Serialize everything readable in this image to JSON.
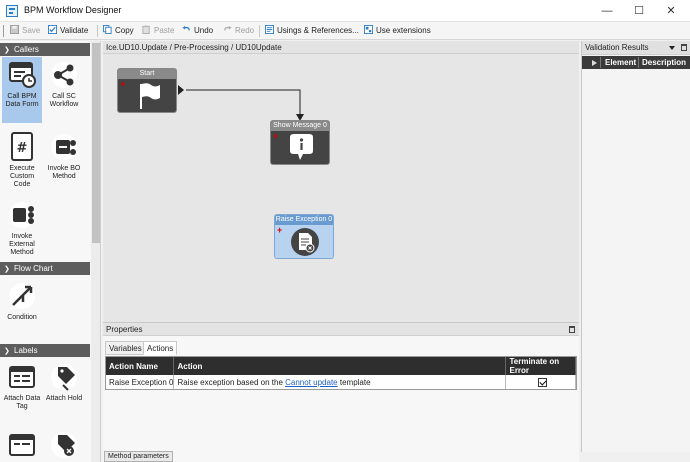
{
  "window": {
    "title": "BPM Workflow Designer",
    "minimize": "—",
    "maximize": "☐",
    "close": "✕"
  },
  "toolbar": {
    "save": "Save",
    "validate": "Validate",
    "copy": "Copy",
    "paste": "Paste",
    "undo": "Undo",
    "redo": "Redo",
    "usings": "Usings & References...",
    "extensions": "Use extensions"
  },
  "sections": {
    "callers": "Callers",
    "flow_chart": "Flow Chart",
    "labels": "Labels"
  },
  "tools": {
    "call_bpm": "Call BPM Data Form",
    "call_sc": "Call SC Workflow",
    "execute_code": "Execute Custom Code",
    "invoke_bo": "Invoke BO Method",
    "invoke_external": "Invoke External Method",
    "condition": "Condition",
    "attach_data_tag": "Attach Data Tag",
    "attach_hold": "Attach Hold"
  },
  "canvas": {
    "breadcrumb": "Ice.UD10.Update / Pre-Processing / UD10Update",
    "nodes": {
      "start": "Start",
      "show_message": "Show Message 0",
      "raise_exception": "Raise Exception 0"
    }
  },
  "properties": {
    "title": "Properties",
    "tabs": [
      "Variables",
      "Actions"
    ],
    "columns": {
      "action_name": "Action Name",
      "action": "Action",
      "terminate": "Terminate on Error"
    },
    "row": {
      "name": "Raise Exception 0",
      "action_prefix": "Raise exception based on the",
      "action_link": "Cannot update",
      "action_suffix": "template",
      "terminate_checked": true
    },
    "bottom_tab": "Method parameters"
  },
  "validation": {
    "title": "Validation Results",
    "columns": {
      "element": "Element",
      "description": "Description"
    }
  },
  "colors": {
    "accent": "#2d7ec9",
    "selected": "#a9c9ec",
    "section_header": "#5d5d5d",
    "link": "#1f5fc6"
  }
}
